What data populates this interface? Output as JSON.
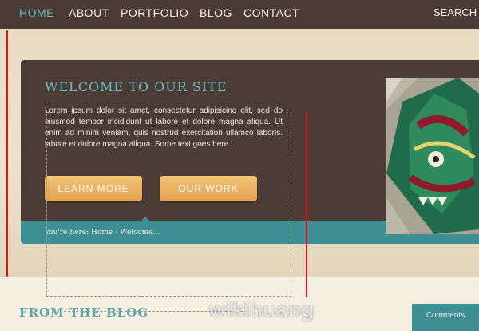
{
  "nav": {
    "items": [
      "HOME",
      "ABOUT",
      "PORTFOLIO",
      "BLOG",
      "CONTACT"
    ],
    "active_index": 0,
    "search_label": "SEARCH"
  },
  "hero": {
    "title": "WELCOME TO OUR SITE",
    "body": "Lorem ipsum dolor sit amet, consectetur adipisicing elit, sed do eiusmod tempor incididunt ut labore et dolore magna aliqua. Ut enim ad minim veniam, quis nostrud exercitation ullamco laboris. labore et dolore magna aliqua. Some text goes here...",
    "buttons": [
      "LEARN MORE",
      "OUR WORK"
    ],
    "breadcrumb": "You're here: Home › Welcome..."
  },
  "blog": {
    "title": "FROM THE BLOG",
    "comments_label": "Comments"
  },
  "watermark": "wikihuang",
  "colors": {
    "nav_bg": "#4a3b35",
    "accent_teal": "#3e8f94",
    "button_orange": "#e3a24e",
    "hero_bg": "#4b3c36"
  }
}
